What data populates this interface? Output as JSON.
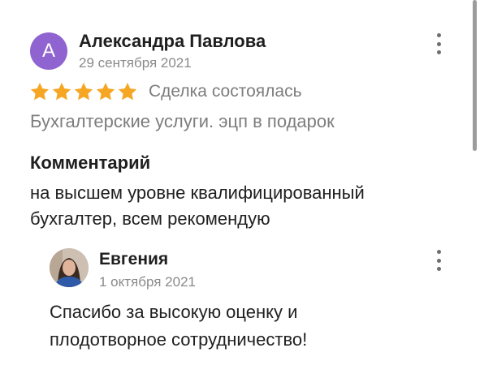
{
  "review": {
    "avatar_letter": "А",
    "author_name": "Александра Павлова",
    "date": "29 сентября 2021",
    "rating": 5,
    "rating_max": 5,
    "deal_status": "Сделка состоялась",
    "service": "Бухгалтерские услуги. эцп в подарок",
    "comment_heading": "Комментарий",
    "comment_text": "на высшем уровне квалифицированный бухгалтер, всем рекомендую"
  },
  "reply": {
    "author_name": "Евгения",
    "date": "1 октября 2021",
    "text": "Спасибо за высокую оценку и плодотворное сотрудничество!"
  },
  "icons": {
    "star": "star-icon",
    "menu": "more-vertical-icon"
  },
  "colors": {
    "avatar_bg": "#8f63d0",
    "star": "#f5a623",
    "text_primary": "#1f1f1f",
    "text_secondary": "#7d7d7d"
  }
}
